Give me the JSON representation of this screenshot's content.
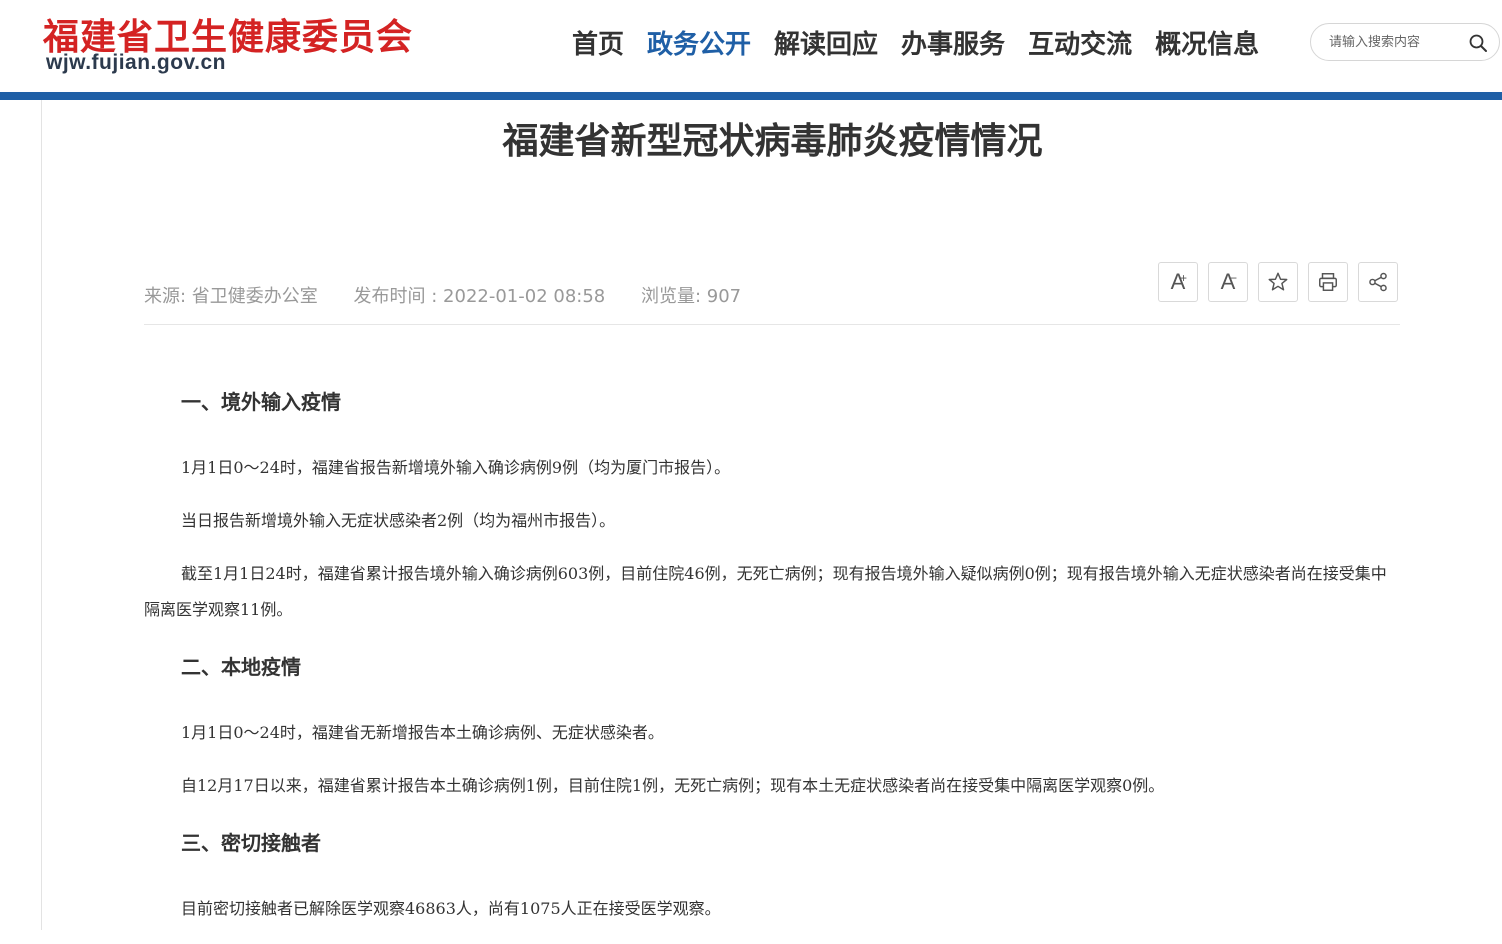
{
  "header": {
    "site_name": "福建省卫生健康委员会",
    "site_domain": "wjw.fujian.gov.cn",
    "nav": [
      "首页",
      "政务公开",
      "解读回应",
      "办事服务",
      "互动交流",
      "概况信息"
    ],
    "active_nav": "政务公开",
    "search_placeholder": "请输入搜索内容"
  },
  "article": {
    "title": "福建省新型冠状病毒肺炎疫情情况",
    "source": "来源: 省卫健委办公室",
    "publish_time": "发布时间 : 2022-01-02 08:58",
    "views": "浏览量:  907",
    "tools": {
      "font_increase": "A",
      "font_decrease": "A"
    },
    "sections": [
      {
        "heading": "一、境外输入疫情",
        "paragraphs": [
          "1月1日0～24时，福建省报告新增境外输入确诊病例9例（均为厦门市报告）。",
          "当日报告新增境外输入无症状感染者2例（均为福州市报告）。",
          "截至1月1日24时，福建省累计报告境外输入确诊病例603例，目前住院46例，无死亡病例；现有报告境外输入疑似病例0例；现有报告境外输入无症状感染者尚在接受集中隔离医学观察11例。"
        ]
      },
      {
        "heading": "二、本地疫情",
        "paragraphs": [
          "1月1日0～24时，福建省无新增报告本土确诊病例、无症状感染者。",
          "自12月17日以来，福建省累计报告本土确诊病例1例，目前住院1例，无死亡病例；现有本土无症状感染者尚在接受集中隔离医学观察0例。"
        ]
      },
      {
        "heading": "三、密切接触者",
        "paragraphs": [
          "目前密切接触者已解除医学观察46863人，尚有1075人正在接受医学观察。"
        ]
      }
    ]
  },
  "colors": {
    "brand_red": "#d42323",
    "accent_blue": "#1f5fa6",
    "meta_gray": "#999999"
  },
  "icons": [
    "search-icon",
    "font-increase-icon",
    "font-decrease-icon",
    "star-icon",
    "print-icon",
    "share-icon"
  ]
}
